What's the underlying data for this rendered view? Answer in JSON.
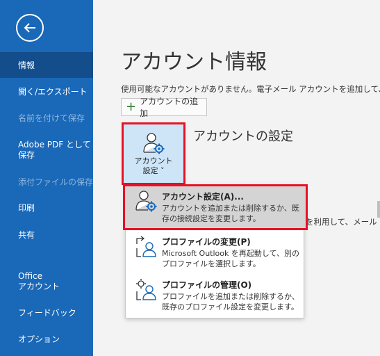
{
  "sidebar": {
    "items": [
      {
        "label": "情報",
        "active": true
      },
      {
        "label": "開く/エクスポート"
      },
      {
        "label": "名前を付けて保存",
        "disabled": true
      },
      {
        "label": "Adobe PDF として\n保存"
      },
      {
        "label": "添付ファイルの保存",
        "disabled": true
      },
      {
        "label": "印刷"
      },
      {
        "label": "共有"
      },
      {
        "label": "Office\nアカウント"
      },
      {
        "label": "フィードバック"
      },
      {
        "label": "オプション"
      }
    ]
  },
  "main": {
    "title": "アカウント情報",
    "description": "使用可能なアカウントがありません。電子メール アカウントを追加して、追加機能",
    "add_account_label": "アカウントの追加",
    "settings_tile_label_line1": "アカウント",
    "settings_tile_label_line2": "設定 ˅",
    "section_title": "アカウントの設定",
    "background_text": "を利用して、メール"
  },
  "dropdown": {
    "items": [
      {
        "title": "アカウント設定(A)...",
        "desc": "アカウントを追加または削除するか、既存の接続設定を変更します。",
        "icon": "account-settings-icon"
      },
      {
        "title": "プロファイルの変更(P)",
        "desc": "Microsoft Outlook を再起動して、別のプロファイルを選択します。",
        "icon": "change-profile-icon"
      },
      {
        "title": "プロファイルの管理(O)",
        "desc": "プロファイルを追加または削除するか、既存のプロファイル設定を変更します。",
        "icon": "manage-profiles-icon"
      }
    ]
  },
  "colors": {
    "sidebar": "#1a68b8",
    "sidebar_active": "#134d8c",
    "highlight_border": "#e81123",
    "tile_bg": "#cde5f7"
  }
}
